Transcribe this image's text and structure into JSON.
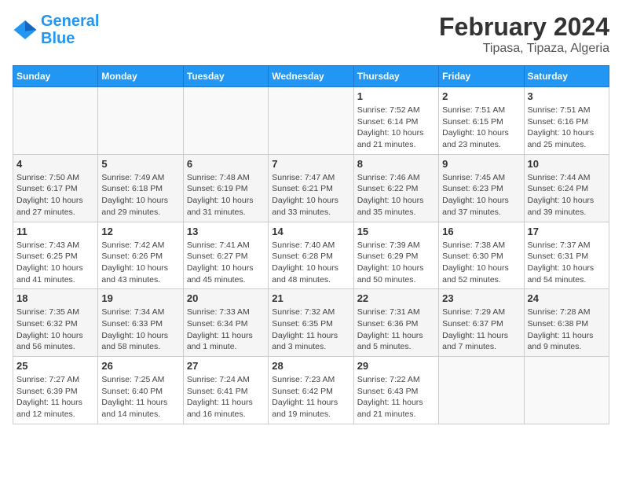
{
  "logo": {
    "text_general": "General",
    "text_blue": "Blue"
  },
  "title": "February 2024",
  "subtitle": "Tipasa, Tipaza, Algeria",
  "days_of_week": [
    "Sunday",
    "Monday",
    "Tuesday",
    "Wednesday",
    "Thursday",
    "Friday",
    "Saturday"
  ],
  "weeks": [
    [
      {
        "day": "",
        "info": ""
      },
      {
        "day": "",
        "info": ""
      },
      {
        "day": "",
        "info": ""
      },
      {
        "day": "",
        "info": ""
      },
      {
        "day": "1",
        "info": "Sunrise: 7:52 AM\nSunset: 6:14 PM\nDaylight: 10 hours\nand 21 minutes."
      },
      {
        "day": "2",
        "info": "Sunrise: 7:51 AM\nSunset: 6:15 PM\nDaylight: 10 hours\nand 23 minutes."
      },
      {
        "day": "3",
        "info": "Sunrise: 7:51 AM\nSunset: 6:16 PM\nDaylight: 10 hours\nand 25 minutes."
      }
    ],
    [
      {
        "day": "4",
        "info": "Sunrise: 7:50 AM\nSunset: 6:17 PM\nDaylight: 10 hours\nand 27 minutes."
      },
      {
        "day": "5",
        "info": "Sunrise: 7:49 AM\nSunset: 6:18 PM\nDaylight: 10 hours\nand 29 minutes."
      },
      {
        "day": "6",
        "info": "Sunrise: 7:48 AM\nSunset: 6:19 PM\nDaylight: 10 hours\nand 31 minutes."
      },
      {
        "day": "7",
        "info": "Sunrise: 7:47 AM\nSunset: 6:21 PM\nDaylight: 10 hours\nand 33 minutes."
      },
      {
        "day": "8",
        "info": "Sunrise: 7:46 AM\nSunset: 6:22 PM\nDaylight: 10 hours\nand 35 minutes."
      },
      {
        "day": "9",
        "info": "Sunrise: 7:45 AM\nSunset: 6:23 PM\nDaylight: 10 hours\nand 37 minutes."
      },
      {
        "day": "10",
        "info": "Sunrise: 7:44 AM\nSunset: 6:24 PM\nDaylight: 10 hours\nand 39 minutes."
      }
    ],
    [
      {
        "day": "11",
        "info": "Sunrise: 7:43 AM\nSunset: 6:25 PM\nDaylight: 10 hours\nand 41 minutes."
      },
      {
        "day": "12",
        "info": "Sunrise: 7:42 AM\nSunset: 6:26 PM\nDaylight: 10 hours\nand 43 minutes."
      },
      {
        "day": "13",
        "info": "Sunrise: 7:41 AM\nSunset: 6:27 PM\nDaylight: 10 hours\nand 45 minutes."
      },
      {
        "day": "14",
        "info": "Sunrise: 7:40 AM\nSunset: 6:28 PM\nDaylight: 10 hours\nand 48 minutes."
      },
      {
        "day": "15",
        "info": "Sunrise: 7:39 AM\nSunset: 6:29 PM\nDaylight: 10 hours\nand 50 minutes."
      },
      {
        "day": "16",
        "info": "Sunrise: 7:38 AM\nSunset: 6:30 PM\nDaylight: 10 hours\nand 52 minutes."
      },
      {
        "day": "17",
        "info": "Sunrise: 7:37 AM\nSunset: 6:31 PM\nDaylight: 10 hours\nand 54 minutes."
      }
    ],
    [
      {
        "day": "18",
        "info": "Sunrise: 7:35 AM\nSunset: 6:32 PM\nDaylight: 10 hours\nand 56 minutes."
      },
      {
        "day": "19",
        "info": "Sunrise: 7:34 AM\nSunset: 6:33 PM\nDaylight: 10 hours\nand 58 minutes."
      },
      {
        "day": "20",
        "info": "Sunrise: 7:33 AM\nSunset: 6:34 PM\nDaylight: 11 hours\nand 1 minute."
      },
      {
        "day": "21",
        "info": "Sunrise: 7:32 AM\nSunset: 6:35 PM\nDaylight: 11 hours\nand 3 minutes."
      },
      {
        "day": "22",
        "info": "Sunrise: 7:31 AM\nSunset: 6:36 PM\nDaylight: 11 hours\nand 5 minutes."
      },
      {
        "day": "23",
        "info": "Sunrise: 7:29 AM\nSunset: 6:37 PM\nDaylight: 11 hours\nand 7 minutes."
      },
      {
        "day": "24",
        "info": "Sunrise: 7:28 AM\nSunset: 6:38 PM\nDaylight: 11 hours\nand 9 minutes."
      }
    ],
    [
      {
        "day": "25",
        "info": "Sunrise: 7:27 AM\nSunset: 6:39 PM\nDaylight: 11 hours\nand 12 minutes."
      },
      {
        "day": "26",
        "info": "Sunrise: 7:25 AM\nSunset: 6:40 PM\nDaylight: 11 hours\nand 14 minutes."
      },
      {
        "day": "27",
        "info": "Sunrise: 7:24 AM\nSunset: 6:41 PM\nDaylight: 11 hours\nand 16 minutes."
      },
      {
        "day": "28",
        "info": "Sunrise: 7:23 AM\nSunset: 6:42 PM\nDaylight: 11 hours\nand 19 minutes."
      },
      {
        "day": "29",
        "info": "Sunrise: 7:22 AM\nSunset: 6:43 PM\nDaylight: 11 hours\nand 21 minutes."
      },
      {
        "day": "",
        "info": ""
      },
      {
        "day": "",
        "info": ""
      }
    ]
  ]
}
